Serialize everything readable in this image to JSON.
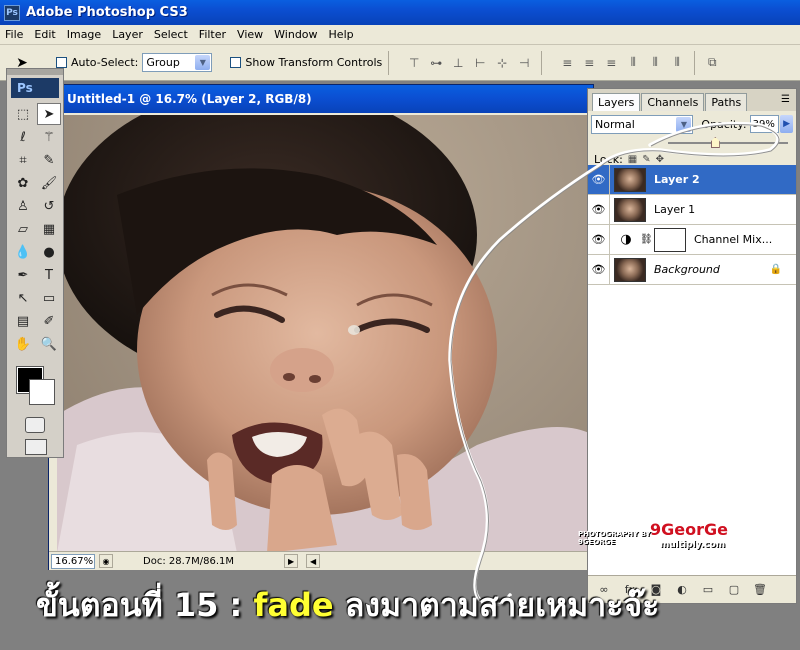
{
  "app": {
    "title": "Adobe Photoshop CS3",
    "logo": "Ps"
  },
  "menu": [
    "File",
    "Edit",
    "Image",
    "Layer",
    "Select",
    "Filter",
    "View",
    "Window",
    "Help"
  ],
  "options": {
    "auto_select_label": "Auto-Select:",
    "auto_select_value": "Group",
    "show_transform_label": "Show Transform Controls"
  },
  "document": {
    "title": "Untitled-1 @ 16.7% (Layer 2, RGB/8)",
    "zoom": "16.67%",
    "doc_info": "Doc: 28.7M/86.1M"
  },
  "tools_panel": {
    "badge": "Ps"
  },
  "layers_panel": {
    "tabs": [
      "Layers",
      "Channels",
      "Paths"
    ],
    "blend_mode": "Normal",
    "opacity_label": "Opacity:",
    "opacity_value": "39%",
    "opacity_fraction": 0.39,
    "lock_label": "Lock:",
    "layers": [
      {
        "name": "Layer 2",
        "selected": true,
        "italic": false,
        "type": "image"
      },
      {
        "name": "Layer 1",
        "selected": false,
        "italic": false,
        "type": "image"
      },
      {
        "name": "Channel Mix...",
        "selected": false,
        "italic": false,
        "type": "adjustment"
      },
      {
        "name": "Background",
        "selected": false,
        "italic": true,
        "type": "background"
      }
    ]
  },
  "overlay": {
    "caption_prefix": "ขั้นตอนที่ 15 : ",
    "caption_highlight": "fade",
    "caption_suffix": " ลงมาตามสายเหมาะจ๊ะ",
    "watermark": "9GeorGe",
    "watermark_sub": "multiply.com",
    "photo_credit": "PHOTOGRAPHY BY 9GEORGE"
  },
  "colors": {
    "titlebar": "#0b4ed1",
    "selection": "#316ac5",
    "caption_highlight": "#ffff33"
  }
}
